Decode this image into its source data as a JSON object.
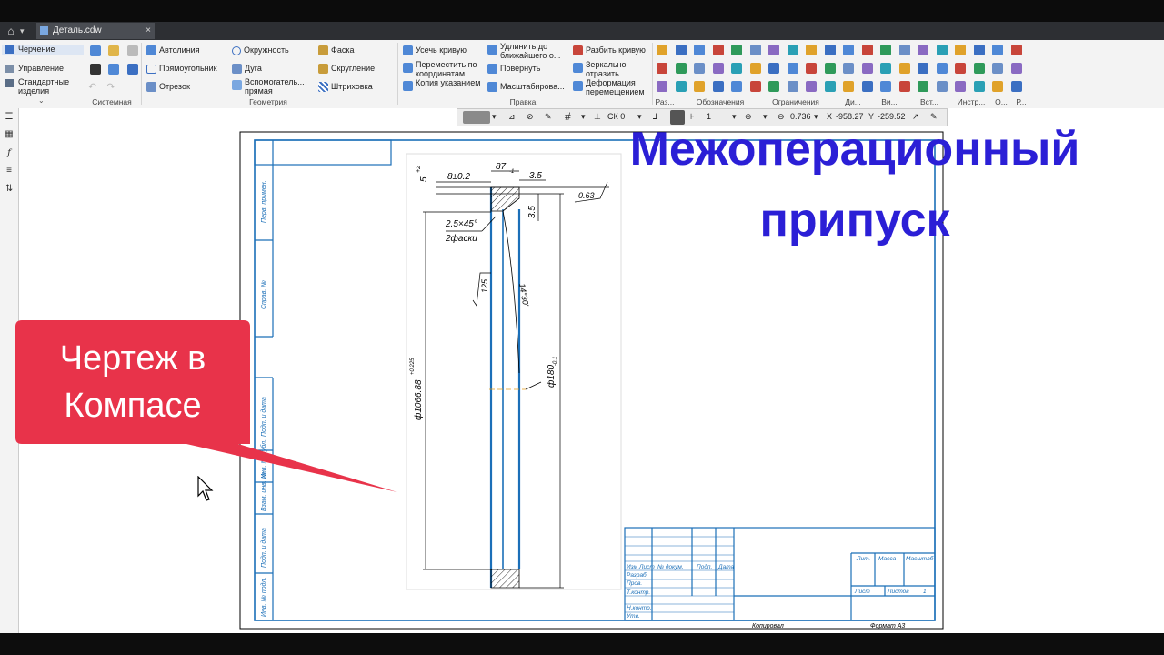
{
  "tab": {
    "home_icon": "home-icon",
    "doc_title": "Деталь.cdw",
    "close": "×"
  },
  "left_panel": {
    "items": [
      "Черчение",
      "Управление",
      "Стандартные изделия"
    ]
  },
  "ribbon": {
    "system_group": "Системная",
    "geometry": {
      "label": "Геометрия",
      "items": [
        "Автолиния",
        "Прямоугольник",
        "Отрезок",
        "Окружность",
        "Дуга",
        "Вспомогатель... прямая",
        "Фаска",
        "Скругление",
        "Штриховка"
      ]
    },
    "edit": {
      "label": "Правка",
      "items": [
        "Усечь кривую",
        "Переместить по координатам",
        "Копия указанием",
        "Удлинить до ближайшего о...",
        "Повернуть",
        "Масштабирова...",
        "Разбить кривую",
        "Зеркально отразить",
        "Деформация перемещением"
      ]
    },
    "group_labels": [
      "Раз...",
      "Обозначения",
      "Ограничения",
      "Ди...",
      "Ви...",
      "Вст...",
      "Инстр...",
      "О...",
      "Р..."
    ]
  },
  "view_toolbar": {
    "cs": "СК 0",
    "scale": "1",
    "zoom": "0.736",
    "x_label": "X",
    "x_value": "-958.27",
    "y_label": "Y",
    "y_value": "-259.52"
  },
  "drawing": {
    "dims": [
      "87",
      "-1",
      "3.5",
      "8±0.2",
      "5",
      "+2",
      "0.63",
      "2.5×45°",
      "2фаски",
      "125",
      "14°30'",
      "ф180",
      "-0.1",
      "ф1066.88",
      "+0.225",
      "3.5"
    ],
    "side_labels": [
      "Перв. примен.",
      "Справ. №",
      "Подп. и дата",
      "Инв. № дубл.",
      "Взам. инв. №",
      "Подп. и дата",
      "Инв. № подл."
    ],
    "title_block": {
      "row_labels": [
        "Изм",
        "Лист",
        "№ докум.",
        "Подп.",
        "Дата"
      ],
      "left_labels": [
        "Разраб.",
        "Пров.",
        "Т.контр.",
        "Н.контр.",
        "Утв."
      ],
      "right_labels": [
        "Лит.",
        "Масса",
        "Масштаб",
        "Лист",
        "Листов",
        "1"
      ],
      "bottom_left": "Копировал",
      "bottom_right": "Формат A3"
    }
  },
  "overlay": {
    "title_line1": "Межоперационный",
    "title_line2": "припуск",
    "callout_line1": "Чертеж в",
    "callout_line2": "Компасе",
    "callout_color": "#e8334a",
    "title_color": "#2b1fd6"
  }
}
